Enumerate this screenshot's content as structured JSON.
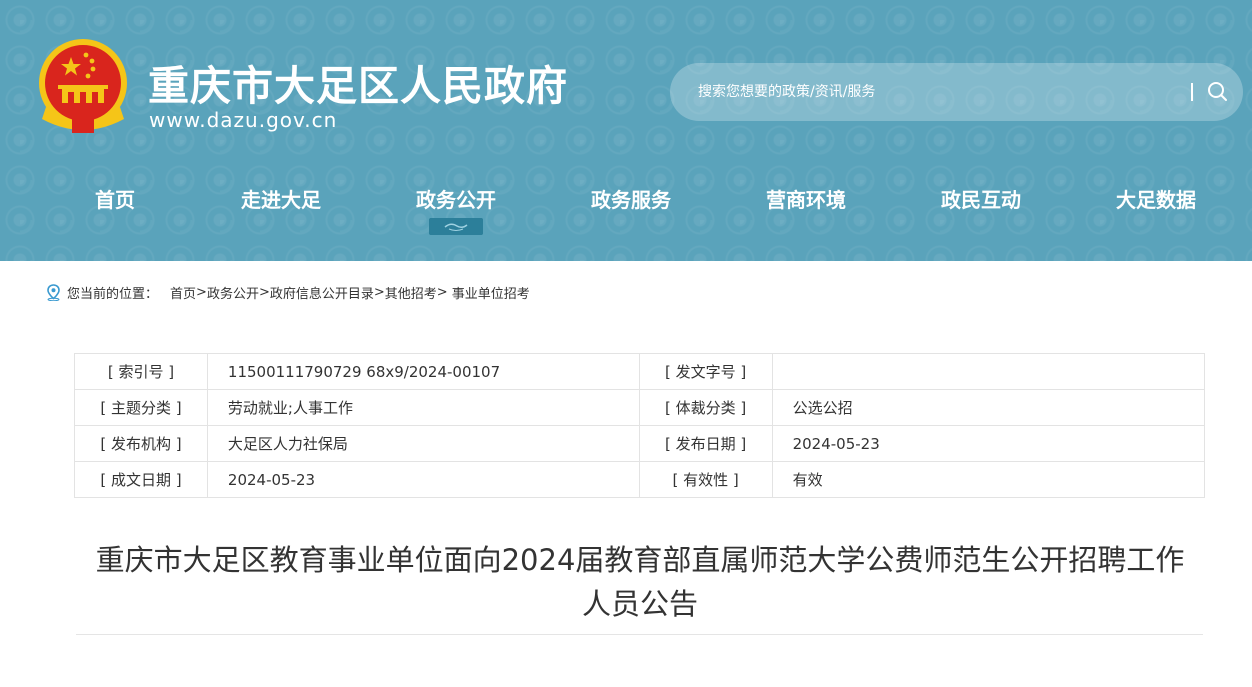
{
  "site": {
    "title": "重庆市大足区人民政府",
    "url": "www.dazu.gov.cn"
  },
  "search": {
    "placeholder": "搜索您想要的政策/资讯/服务"
  },
  "nav": {
    "items": [
      {
        "label": "首页",
        "active": false
      },
      {
        "label": "走进大足",
        "active": false
      },
      {
        "label": "政务公开",
        "active": true
      },
      {
        "label": "政务服务",
        "active": false
      },
      {
        "label": "营商环境",
        "active": false
      },
      {
        "label": "政民互动",
        "active": false
      },
      {
        "label": "大足数据",
        "active": false
      }
    ]
  },
  "breadcrumb": {
    "prefix": "您当前的位置：",
    "items": [
      "首页",
      "政务公开",
      "政府信息公开目录",
      "其他招考",
      "事业单位招考"
    ],
    "separator": ">"
  },
  "meta": {
    "rows": [
      {
        "label1": "[ 索引号 ]",
        "value1": "11500111790729 68x9/2024-00107",
        "label2": "[ 发文字号 ]",
        "value2": ""
      },
      {
        "label1": "[ 主题分类 ]",
        "value1": "劳动就业;人事工作",
        "label2": "[ 体裁分类 ]",
        "value2": "公选公招"
      },
      {
        "label1": "[ 发布机构 ]",
        "value1": "大足区人力社保局",
        "label2": "[ 发布日期 ]",
        "value2": "2024-05-23"
      },
      {
        "label1": "[ 成文日期 ]",
        "value1": "2024-05-23",
        "label2": "[ 有效性 ]",
        "value2": "有效"
      }
    ]
  },
  "article": {
    "title_line1": "重庆市大足区教育事业单位面向2024届教育部直属师范大学公费师范生公开招聘工作",
    "title_line2": "人员公告"
  },
  "colors": {
    "header_bg": "#5aa3bb",
    "nav_active_marker": "#2c7f9a",
    "emblem_red": "#d9251d",
    "emblem_gold": "#f5c518"
  },
  "icons": {
    "search": "search-icon",
    "location": "location-pin-icon",
    "emblem": "national-emblem-icon"
  }
}
